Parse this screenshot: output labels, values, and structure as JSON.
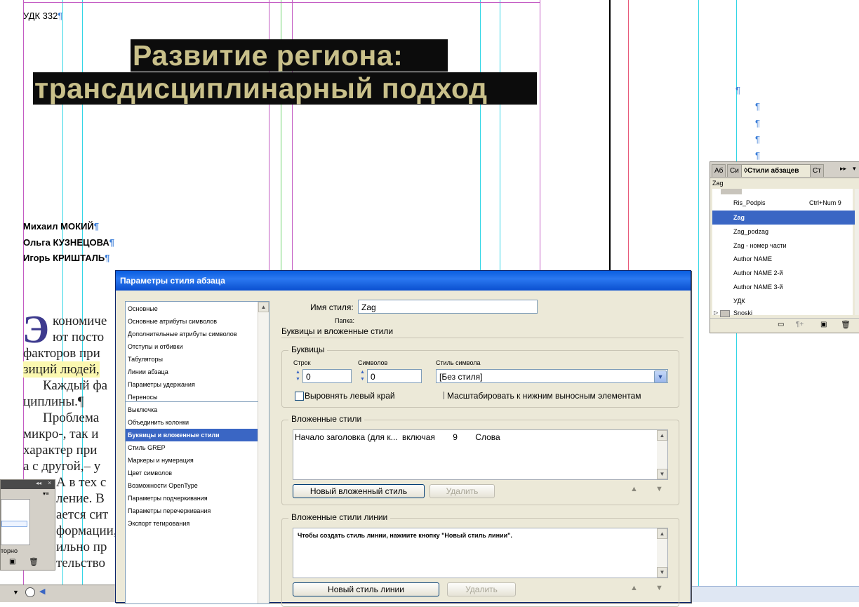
{
  "document": {
    "udk": "УДК 332",
    "title_line1": "Развитие региона:",
    "title_line2": "трансдисциплинарный подход",
    "pilcrow": "¶",
    "authors": [
      "Михаил МОКИЙ",
      "Ольга КУЗНЕЦОВА",
      "Игорь КРИШТАЛЬ"
    ],
    "dropcap": "Э",
    "body_lines": [
      "кономиче",
      "ют посто",
      "факторов при",
      "зиций людей,",
      "Каждый фа",
      "циплины.¶",
      "Проблема",
      "микро-, так и",
      "характер при",
      "а с другой,– у",
      "А в тех с",
      "ление. В",
      "ается сит",
      "формации,",
      "ильно пр",
      "тельство"
    ]
  },
  "styles_panel": {
    "tabs": [
      "Аб",
      "Си",
      "Стили абзацев",
      "Ст"
    ],
    "current": "Zag",
    "items": [
      {
        "name": "Ris_Podpis",
        "shortcut": "Ctrl+Num 9"
      },
      {
        "name": "Zag",
        "shortcut": ""
      },
      {
        "name": "Zag_podzag",
        "shortcut": ""
      },
      {
        "name": "Zag - номер части",
        "shortcut": ""
      },
      {
        "name": "Author NAME",
        "shortcut": ""
      },
      {
        "name": "Author NAME 2-й",
        "shortcut": ""
      },
      {
        "name": "Author NAME 3-й",
        "shortcut": ""
      },
      {
        "name": "УДК",
        "shortcut": ""
      },
      {
        "name": "Snoski",
        "shortcut": ""
      }
    ],
    "selected_index": 1
  },
  "small_panel": {
    "label": "торно"
  },
  "dialog": {
    "title": "Параметры стиля абзаца",
    "categories": [
      "Основные",
      "Основные атрибуты символов",
      "Дополнительные атрибуты символов",
      "Отступы и отбивки",
      "Табуляторы",
      "Линии абзаца",
      "Параметры удержания",
      "Переносы",
      "Выключка",
      "Объединить колонки",
      "Буквицы и вложенные стили",
      "Стиль GREP",
      "Маркеры и нумерация",
      "Цвет символов",
      "Возможности OpenType",
      "Параметры подчеркивания",
      "Параметры перечеркивания",
      "Экспорт тегирования"
    ],
    "selected_category": 10,
    "style_name_label": "Имя стиля:",
    "style_name_value": "Zag",
    "folder_label": "Папка:",
    "section_title": "Буквицы и вложенные стили",
    "dropcaps": {
      "group_title": "Буквицы",
      "lines_label": "Строк",
      "lines_value": "0",
      "chars_label": "Символов",
      "chars_value": "0",
      "char_style_label": "Стиль символа",
      "char_style_value": "[Без стиля]",
      "align_left_label": "Выровнять левый край",
      "align_left_checked": false,
      "scale_label": "Масштабировать к нижним выносным элементам",
      "scale_checked": false
    },
    "nested": {
      "group_title": "Вложенные стили",
      "rows": [
        {
          "style": "Начало заголовка (для к...",
          "mode": "включая",
          "count": "9",
          "unit": "Слова"
        }
      ],
      "new_button": "Новый вложенный стиль",
      "delete_button": "Удалить"
    },
    "line_styles": {
      "group_title": "Вложенные стили линии",
      "hint": "Чтобы создать стиль линии, нажмите кнопку \"Новый стиль линии\".",
      "new_button": "Новый стиль линии",
      "delete_button": "Удалить"
    }
  }
}
